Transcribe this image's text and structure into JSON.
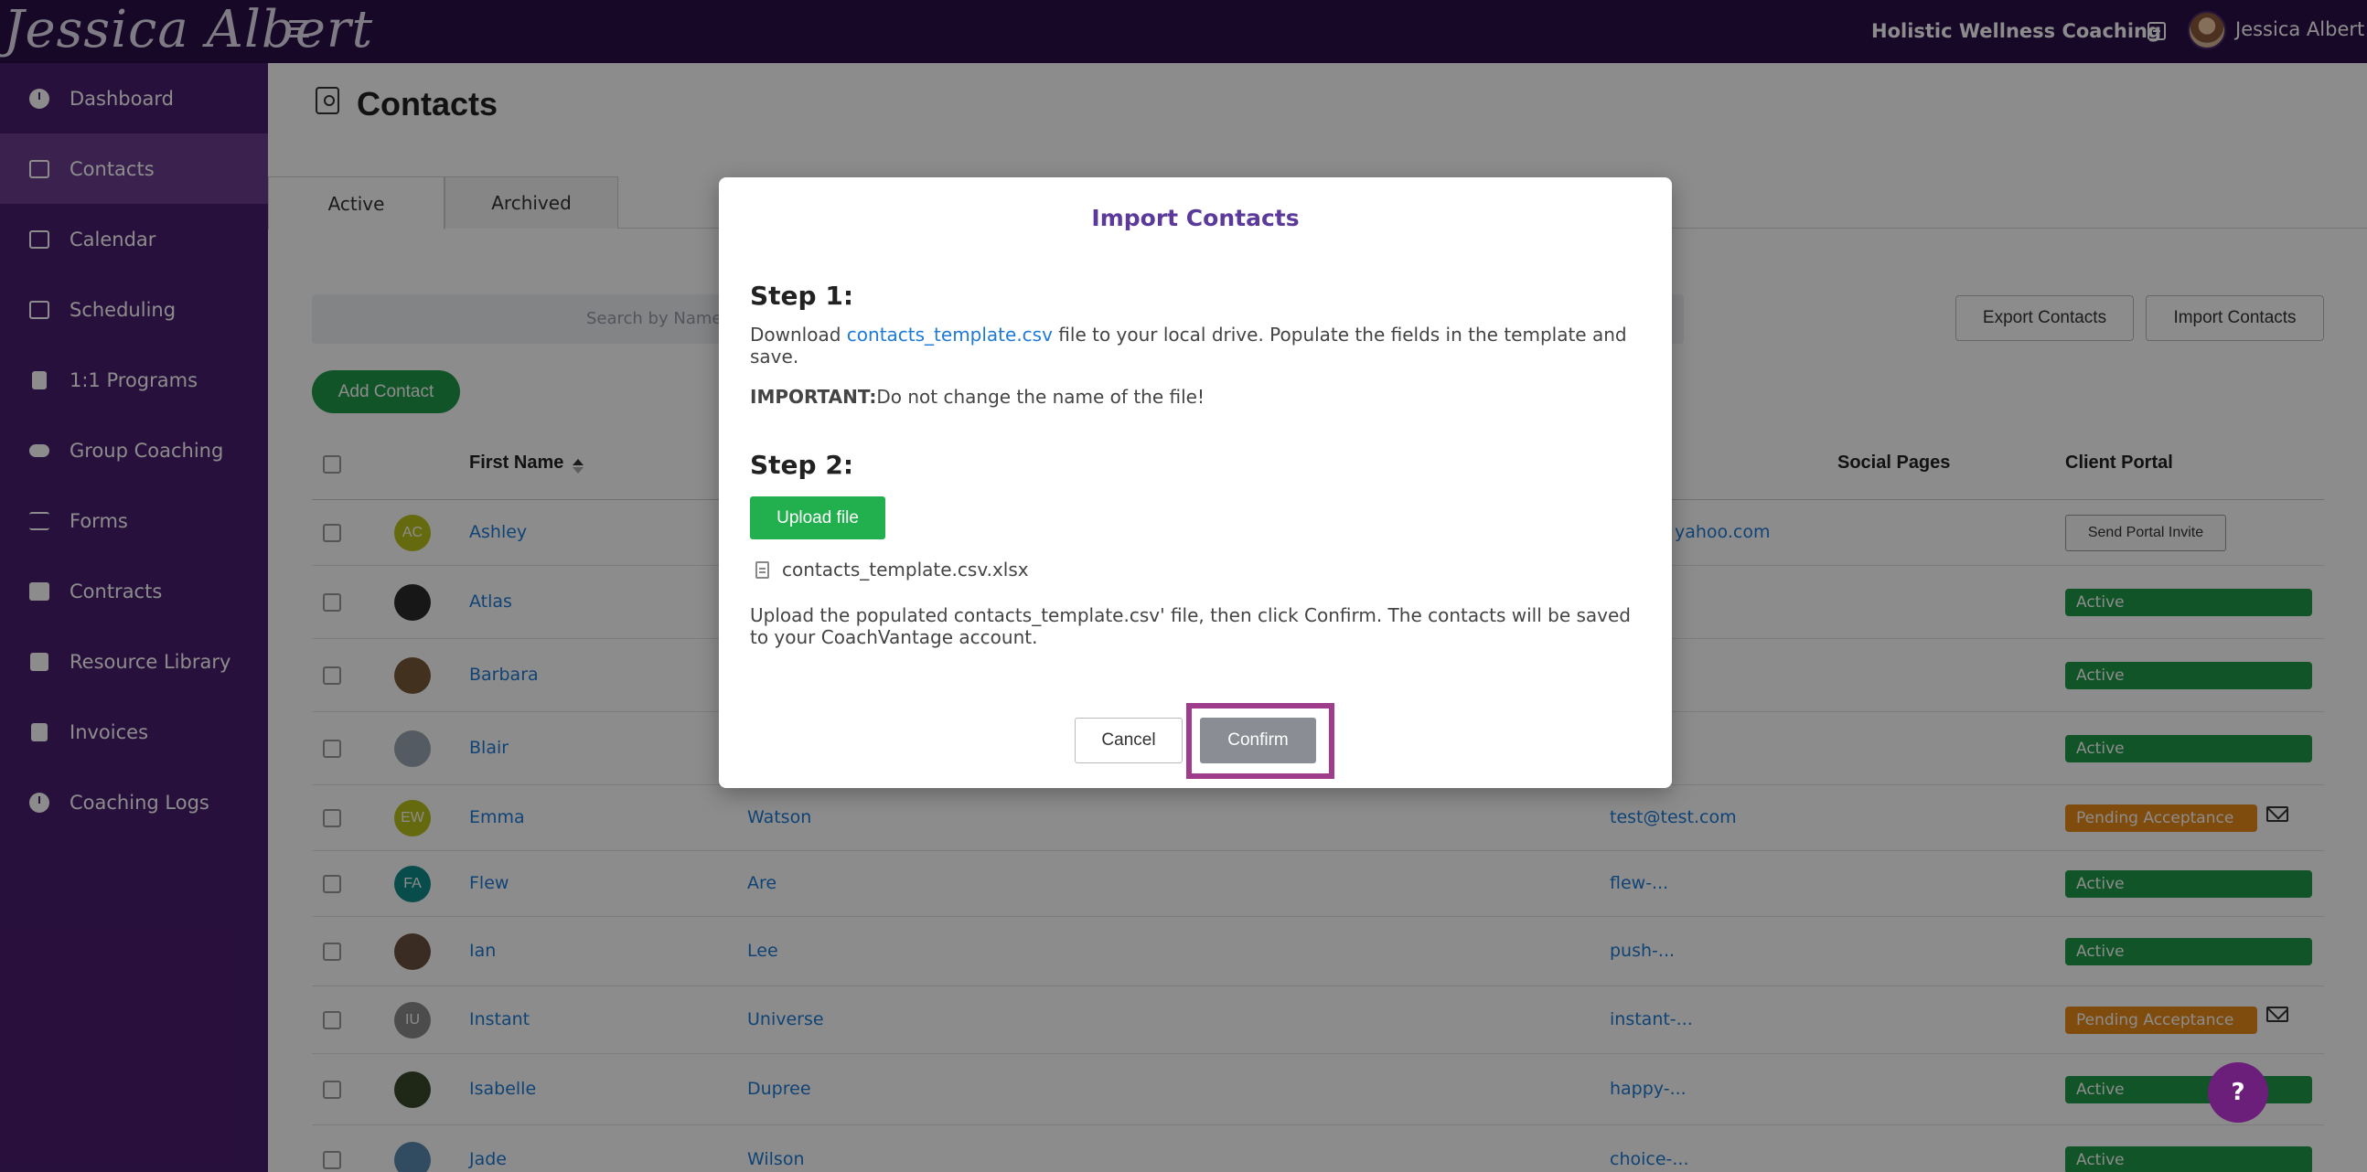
{
  "topbar": {
    "logo_text": "Jessica Albert",
    "business_name": "Holistic Wellness Coaching",
    "user_name": "Jessica Albert"
  },
  "sidebar": {
    "items": [
      {
        "label": "Dashboard",
        "icon": "dashboard-icon"
      },
      {
        "label": "Contacts",
        "icon": "contacts-icon",
        "active": true
      },
      {
        "label": "Calendar",
        "icon": "calendar-icon"
      },
      {
        "label": "Scheduling",
        "icon": "scheduling-icon"
      },
      {
        "label": "1:1 Programs",
        "icon": "book-icon"
      },
      {
        "label": "Group Coaching",
        "icon": "group-icon"
      },
      {
        "label": "Forms",
        "icon": "forms-icon"
      },
      {
        "label": "Contracts",
        "icon": "contract-icon"
      },
      {
        "label": "Resource Library",
        "icon": "library-icon"
      },
      {
        "label": "Invoices",
        "icon": "invoice-icon"
      },
      {
        "label": "Coaching Logs",
        "icon": "clock-icon"
      }
    ]
  },
  "main": {
    "page_title": "Contacts",
    "tabs": [
      {
        "label": "Active",
        "active": true
      },
      {
        "label": "Archived"
      }
    ],
    "search_placeholder": "Search by Name or Ta",
    "export_label": "Export Contacts",
    "import_label": "Import Contacts",
    "add_contact_label": "Add Contact",
    "columns": {
      "first_name": "First Name",
      "social_pages": "Social Pages",
      "client_portal": "Client Portal"
    },
    "rows": [
      {
        "first": "Ashley",
        "last": "",
        "email": "yahoo.com",
        "initials": "AC",
        "avatar_color": "#b8c21a",
        "status": "Send Portal Invite",
        "status_type": "invite"
      },
      {
        "first": "Atlas",
        "last": "",
        "email": "",
        "initials": "",
        "avatar_color": "#2b2b2b",
        "status": "Active",
        "status_type": "green"
      },
      {
        "first": "Barbara",
        "last": "",
        "email": "",
        "initials": "",
        "avatar_color": "#7a5a3a",
        "status": "Active",
        "status_type": "green"
      },
      {
        "first": "Blair",
        "last": "",
        "email": "",
        "initials": "",
        "avatar_color": "#9aa6b4",
        "status": "Active",
        "status_type": "green"
      },
      {
        "first": "Emma",
        "last": "Watson",
        "email": "test@test.com",
        "initials": "EW",
        "avatar_color": "#b8c21a",
        "status": "Pending Acceptance",
        "status_type": "orange"
      },
      {
        "first": "Flew",
        "last": "Are",
        "email": "flew-...",
        "initials": "FA",
        "avatar_color": "#0f8a8a",
        "status": "Active",
        "status_type": "green"
      },
      {
        "first": "Ian",
        "last": "Lee",
        "email": "push-...",
        "initials": "",
        "avatar_color": "#6a5040",
        "status": "Active",
        "status_type": "green"
      },
      {
        "first": "Instant",
        "last": "Universe",
        "email": "instant-...",
        "initials": "IU",
        "avatar_color": "#8a8a8a",
        "status": "Pending Acceptance",
        "status_type": "orange"
      },
      {
        "first": "Isabelle",
        "last": "Dupree",
        "email": "happy-...",
        "initials": "",
        "avatar_color": "#3a4a2a",
        "status": "Active",
        "status_type": "green"
      },
      {
        "first": "Jade",
        "last": "Wilson",
        "email": "choice-...",
        "initials": "",
        "avatar_color": "#5a8ab0",
        "status": "Active",
        "status_type": "green"
      }
    ]
  },
  "modal": {
    "title": "Import Contacts",
    "step1_heading": "Step 1:",
    "step1_prefix": "Download ",
    "step1_link": "contacts_template.csv",
    "step1_suffix": " file to your local drive. Populate the fields in the template and save.",
    "important_label": "IMPORTANT:",
    "important_text": "Do not change the name of the file!",
    "step2_heading": "Step 2:",
    "upload_label": "Upload file",
    "file_name": "contacts_template.csv.xlsx",
    "step2_text": "Upload the populated contacts_template.csv' file, then click Confirm. The contacts will be saved to your CoachVantage account.",
    "cancel_label": "Cancel",
    "confirm_label": "Confirm"
  },
  "help_label": "?",
  "colors": {
    "sidebar": "#4a1e6e",
    "topbar": "#2a0f4a",
    "accent": "#5b3a9c",
    "active_green": "#1f9a4a",
    "pending_orange": "#e88a1a",
    "highlight": "#a03c8c"
  }
}
